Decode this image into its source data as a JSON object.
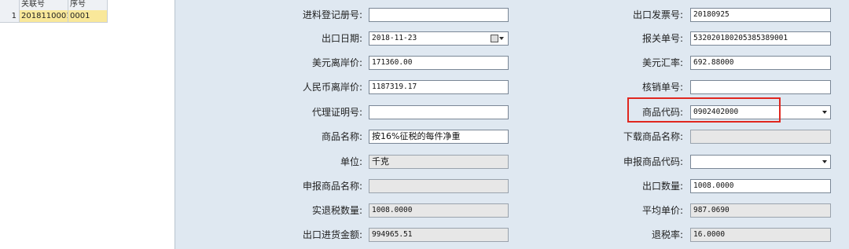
{
  "grid": {
    "headers": [
      "关联号",
      "序号"
    ],
    "rows": [
      {
        "num": "1",
        "key": "2018110001",
        "seq": "0001"
      }
    ]
  },
  "form": {
    "left": [
      {
        "label": "进料登记册号:",
        "value": "",
        "readonly": false
      },
      {
        "label": "出口日期:",
        "value": "2018-11-23",
        "readonly": false,
        "control": "date"
      },
      {
        "label": "美元离岸价:",
        "value": "171360.00",
        "readonly": false
      },
      {
        "label": "人民币离岸价:",
        "value": "1187319.17",
        "readonly": false
      },
      {
        "label": "代理证明号:",
        "value": "",
        "readonly": false
      },
      {
        "label": "商品名称:",
        "value": "按16%征税的每件净重",
        "readonly": false
      },
      {
        "label": "单位:",
        "value": "千克",
        "readonly": true
      },
      {
        "label": "申报商品名称:",
        "value": "",
        "readonly": true
      },
      {
        "label": "实退税数量:",
        "value": "1008.0000",
        "readonly": true
      },
      {
        "label": "出口进货金额:",
        "value": "994965.51",
        "readonly": true
      }
    ],
    "right": [
      {
        "label": "出口发票号:",
        "value": "20180925",
        "readonly": false
      },
      {
        "label": "报关单号:",
        "value": "532020180205385389001",
        "readonly": false
      },
      {
        "label": "美元汇率:",
        "value": "692.88000",
        "readonly": false
      },
      {
        "label": "核销单号:",
        "value": "",
        "readonly": false
      },
      {
        "label": "商品代码:",
        "value": "0902402000",
        "readonly": false,
        "control": "dropdown"
      },
      {
        "label": "下载商品名称:",
        "value": "",
        "readonly": true
      },
      {
        "label": "申报商品代码:",
        "value": "",
        "readonly": false,
        "control": "dropdown"
      },
      {
        "label": "出口数量:",
        "value": "1008.0000",
        "readonly": false
      },
      {
        "label": "平均单价:",
        "value": "987.0690",
        "readonly": true
      },
      {
        "label": "退税率:",
        "value": "16.0000",
        "readonly": true
      }
    ]
  },
  "colors": {
    "highlight": "#e0271f",
    "panel": "#dfe8f1",
    "selected_row": "#f9e89a"
  }
}
